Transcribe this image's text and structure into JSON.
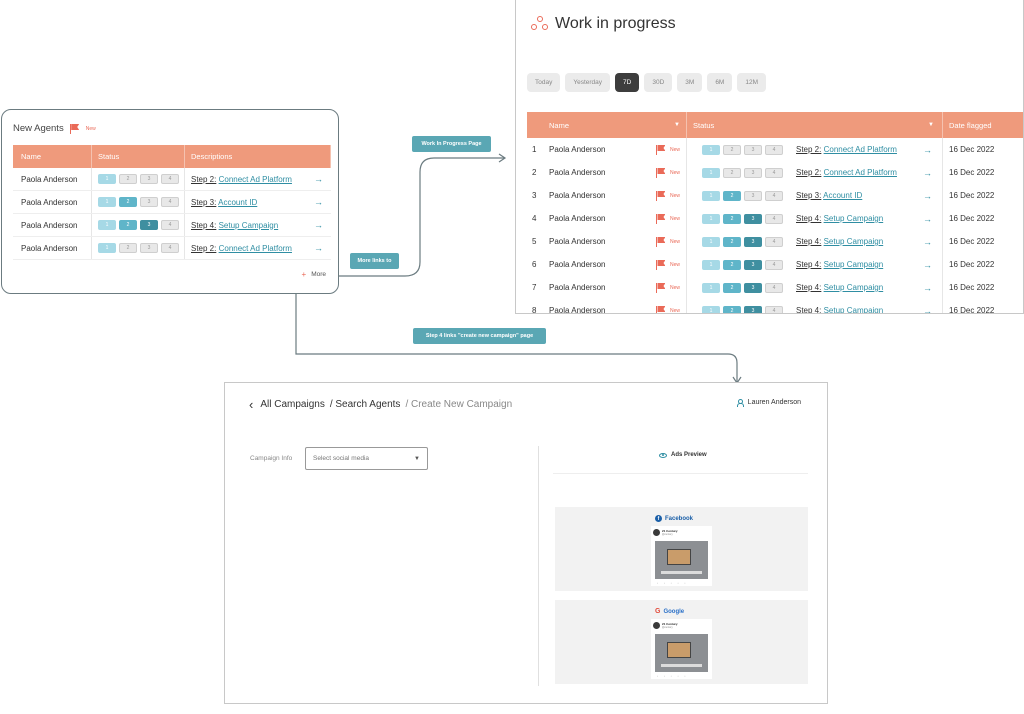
{
  "new_agents": {
    "title": "New Agents",
    "badge": "New",
    "columns": [
      "Name",
      "Status",
      "Descriptions"
    ],
    "rows": [
      {
        "name": "Paola Anderson",
        "steps": [
          "1",
          "2",
          "3",
          "4"
        ],
        "desc_prefix": "Step 2:",
        "desc_link": "Connect Ad Platform"
      },
      {
        "name": "Paola Anderson",
        "steps": [
          "1",
          "2",
          "3",
          "4"
        ],
        "desc_prefix": "Step 3:",
        "desc_link": "Account ID"
      },
      {
        "name": "Paola Anderson",
        "steps": [
          "1",
          "2",
          "3",
          "4"
        ],
        "desc_prefix": "Step 4:",
        "desc_link": "Setup Campaign"
      },
      {
        "name": "Paola Anderson",
        "steps": [
          "1",
          "2",
          "3",
          "4"
        ],
        "desc_prefix": "Step 2:",
        "desc_link": "Connect Ad Platform"
      }
    ],
    "more_label": "More",
    "arrow_icon": "→"
  },
  "callouts": {
    "wip_page": "Work In Progress Page",
    "more_links": "More links to",
    "step4": "Step 4 links \"create new campaign\" page"
  },
  "wip": {
    "title": "Work in progress",
    "filters": [
      "Today",
      "Yesterday",
      "7D",
      "30D",
      "3M",
      "6M",
      "12M"
    ],
    "active_filter": "7D",
    "columns": {
      "name": "Name",
      "status": "Status",
      "date": "Date flagged"
    },
    "rows": [
      {
        "num": "1",
        "name": "Paola Anderson",
        "badge": "New",
        "desc_prefix": "Step 2:",
        "desc_link": "Connect Ad Platform",
        "date": "16 Dec 2022"
      },
      {
        "num": "2",
        "name": "Paola Anderson",
        "badge": "New",
        "desc_prefix": "Step 2:",
        "desc_link": "Connect Ad Platform",
        "date": "16 Dec 2022"
      },
      {
        "num": "3",
        "name": "Paola Anderson",
        "badge": "New",
        "desc_prefix": "Step 3:",
        "desc_link": "Account ID",
        "date": "16 Dec 2022"
      },
      {
        "num": "4",
        "name": "Paola Anderson",
        "badge": "New",
        "desc_prefix": "Step 4:",
        "desc_link": "Setup Campaign",
        "date": "16 Dec 2022"
      },
      {
        "num": "5",
        "name": "Paola Anderson",
        "badge": "New",
        "desc_prefix": "Step 4:",
        "desc_link": "Setup Campaign",
        "date": "16 Dec 2022"
      },
      {
        "num": "6",
        "name": "Paola Anderson",
        "badge": "New",
        "desc_prefix": "Step 4:",
        "desc_link": "Setup Campaign",
        "date": "16 Dec 2022"
      },
      {
        "num": "7",
        "name": "Paola Anderson",
        "badge": "New",
        "desc_prefix": "Step 4:",
        "desc_link": "Setup Campaign",
        "date": "16 Dec 2022"
      },
      {
        "num": "8",
        "name": "Paola Anderson",
        "badge": "New",
        "desc_prefix": "Step 4:",
        "desc_link": "Setup Campaign",
        "date": "16 Dec 2022"
      }
    ]
  },
  "campaign": {
    "breadcrumb": [
      "All Campaigns",
      "/ Search Agents",
      "/ Create New Campaign"
    ],
    "back_icon": "‹",
    "user": "Lauren Anderson",
    "campaign_info_label": "Campaign Info",
    "select_placeholder": "Select social media",
    "preview_title": "Ads Preview",
    "ads": [
      {
        "platform": "Facebook",
        "page_name": "21 Century",
        "handle": "@century"
      },
      {
        "platform": "Google",
        "page_name": "21 Century",
        "handle": "@century"
      }
    ]
  },
  "colors": {
    "header_salmon": "#ef9a7c",
    "accent_teal": "#2f8ea3",
    "callout_teal": "#5aa7b4",
    "flag_red": "#ea6a58"
  }
}
